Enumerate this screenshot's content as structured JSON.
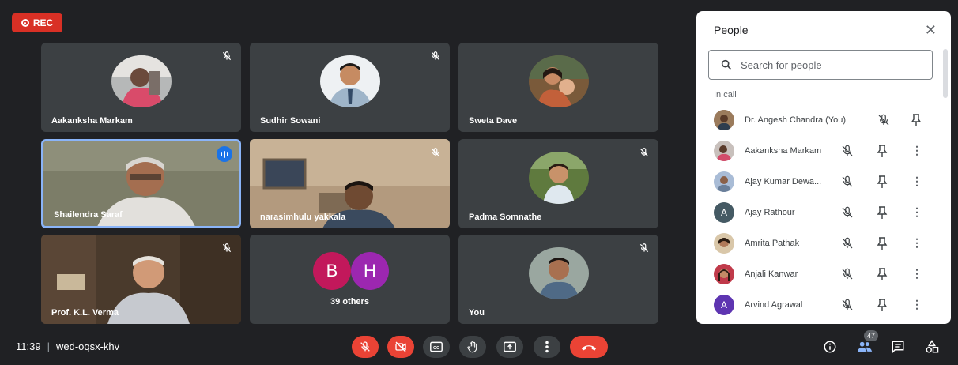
{
  "recording": {
    "label": "REC"
  },
  "tiles": [
    {
      "name": "Aakanksha Markam"
    },
    {
      "name": "Sudhir Sowani"
    },
    {
      "name": "Sweta Dave"
    },
    {
      "name": "Shailendra Saraf"
    },
    {
      "name": "narasimhulu yakkala"
    },
    {
      "name": "Padma Somnathe"
    },
    {
      "name": "Prof. K.L. Verma"
    },
    {
      "name": "39 others",
      "initials": [
        "B",
        "H"
      ]
    },
    {
      "name": "You"
    }
  ],
  "panel": {
    "title": "People",
    "search_placeholder": "Search for people",
    "section_label": "In call",
    "people": [
      {
        "name": "Dr. Angesh Chandra (You)"
      },
      {
        "name": "Aakanksha Markam"
      },
      {
        "name": "Ajay Kumar Dewa..."
      },
      {
        "name": "Ajay Rathour",
        "initial": "A",
        "color": "#455a64"
      },
      {
        "name": "Amrita Pathak"
      },
      {
        "name": "Anjali Kanwar"
      },
      {
        "name": "Arvind Agrawal",
        "initial": "A",
        "color": "#5e35b1"
      }
    ]
  },
  "bottom": {
    "time": "11:39",
    "meeting_code": "wed-oqsx-khv",
    "participant_count": "47"
  },
  "colors": {
    "accent_red": "#ea4335",
    "accent_blue": "#1a73e8",
    "background": "#202124"
  }
}
